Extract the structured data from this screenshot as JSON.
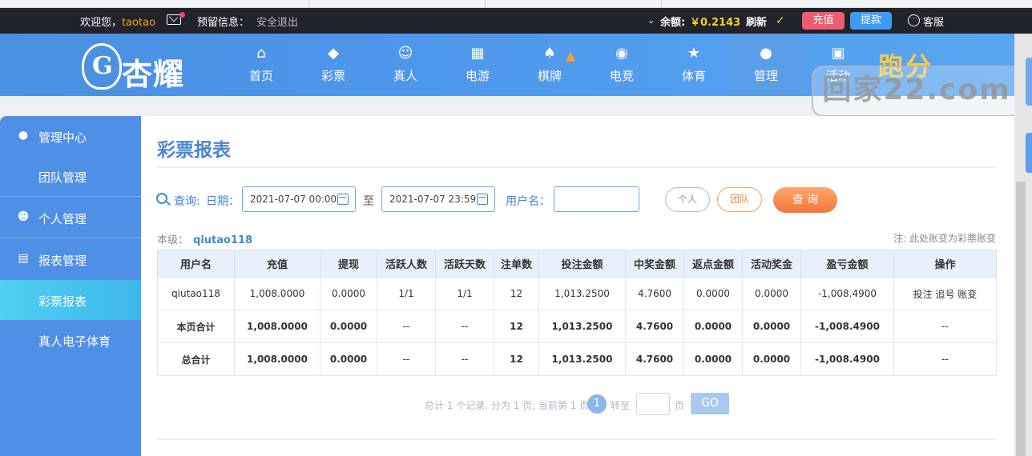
{
  "topbar": {
    "welcome": "欢迎您，",
    "username": "taotao",
    "notice_label": "预留信息：",
    "logout": "安全退出",
    "balance_label": "余额:",
    "balance_value": "￥0.2143",
    "refresh": "刷新",
    "recharge": "充值",
    "withdraw": "提款",
    "service": "客服"
  },
  "logo": {
    "text": "杏耀",
    "crest": "G"
  },
  "nav": [
    {
      "label": "首页",
      "icon": "home-icon"
    },
    {
      "label": "彩票",
      "icon": "ticket-icon"
    },
    {
      "label": "真人",
      "icon": "person-icon"
    },
    {
      "label": "电游",
      "icon": "slot-icon"
    },
    {
      "label": "棋牌",
      "icon": "cards-icon"
    },
    {
      "label": "电竞",
      "icon": "gamepad-icon"
    },
    {
      "label": "体育",
      "icon": "trophy-icon"
    },
    {
      "label": "管理",
      "icon": "users-icon"
    },
    {
      "label": "活动",
      "icon": "gift-icon"
    }
  ],
  "promo": "跑分",
  "watermark": "回家22.com",
  "sidebar": {
    "groups": [
      {
        "label": "管理中心",
        "icon": "users-icon"
      },
      {
        "label": "个人管理",
        "icon": "user-icon"
      },
      {
        "label": "报表管理",
        "icon": "report-icon"
      }
    ],
    "subs": {
      "team": "团队管理",
      "lottery_report": "彩票报表",
      "live_sports": "真人电子体育"
    }
  },
  "main": {
    "title": "彩票报表",
    "query_label": "查询:",
    "date_label": "日期：",
    "date_from": "2021-07-07 00:00",
    "to_label": "至",
    "date_to": "2021-07-07 23:59",
    "username_label": "用户名：",
    "username_value": "",
    "btn_personal": "个人",
    "btn_team": "团队",
    "btn_query": "查 询",
    "level_label": "本级：",
    "level_user": "qiutao118",
    "note": "注: 此处账变为彩票账变"
  },
  "table": {
    "headers": [
      "用户名",
      "充值",
      "提现",
      "活跃人数",
      "活跃天数",
      "注单数",
      "投注金额",
      "中奖金额",
      "返点金额",
      "活动奖金",
      "盈亏金额",
      "操作"
    ],
    "row": [
      "qiutao118",
      "1,008.0000",
      "0.0000",
      "1/1",
      "1/1",
      "12",
      "1,013.2500",
      "4.7600",
      "0.0000",
      "0.0000",
      "-1,008.4900"
    ],
    "row_actions": "投注 追号 账变",
    "page_total": [
      "本页合计",
      "1,008.0000",
      "0.0000",
      "--",
      "--",
      "12",
      "1,013.2500",
      "4.7600",
      "0.0000",
      "0.0000",
      "-1,008.4900",
      "--"
    ],
    "grand_total": [
      "总合计",
      "1,008.0000",
      "0.0000",
      "--",
      "--",
      "12",
      "1,013.2500",
      "4.7600",
      "0.0000",
      "0.0000",
      "-1,008.4900",
      "--"
    ]
  },
  "pager": {
    "summary": "总计 1 个记录, 分为 1 页, 当前第 1 页",
    "current": "1",
    "goto_label": "转至",
    "page_label": "页",
    "go": "GO"
  },
  "colors": {
    "header_blue": "#4e97ec",
    "sidebar_blue": "#4f8fe6",
    "active_cyan": "#4fd0f0",
    "negative_red": "#e23a3a",
    "accent_orange": "#f4763c"
  }
}
